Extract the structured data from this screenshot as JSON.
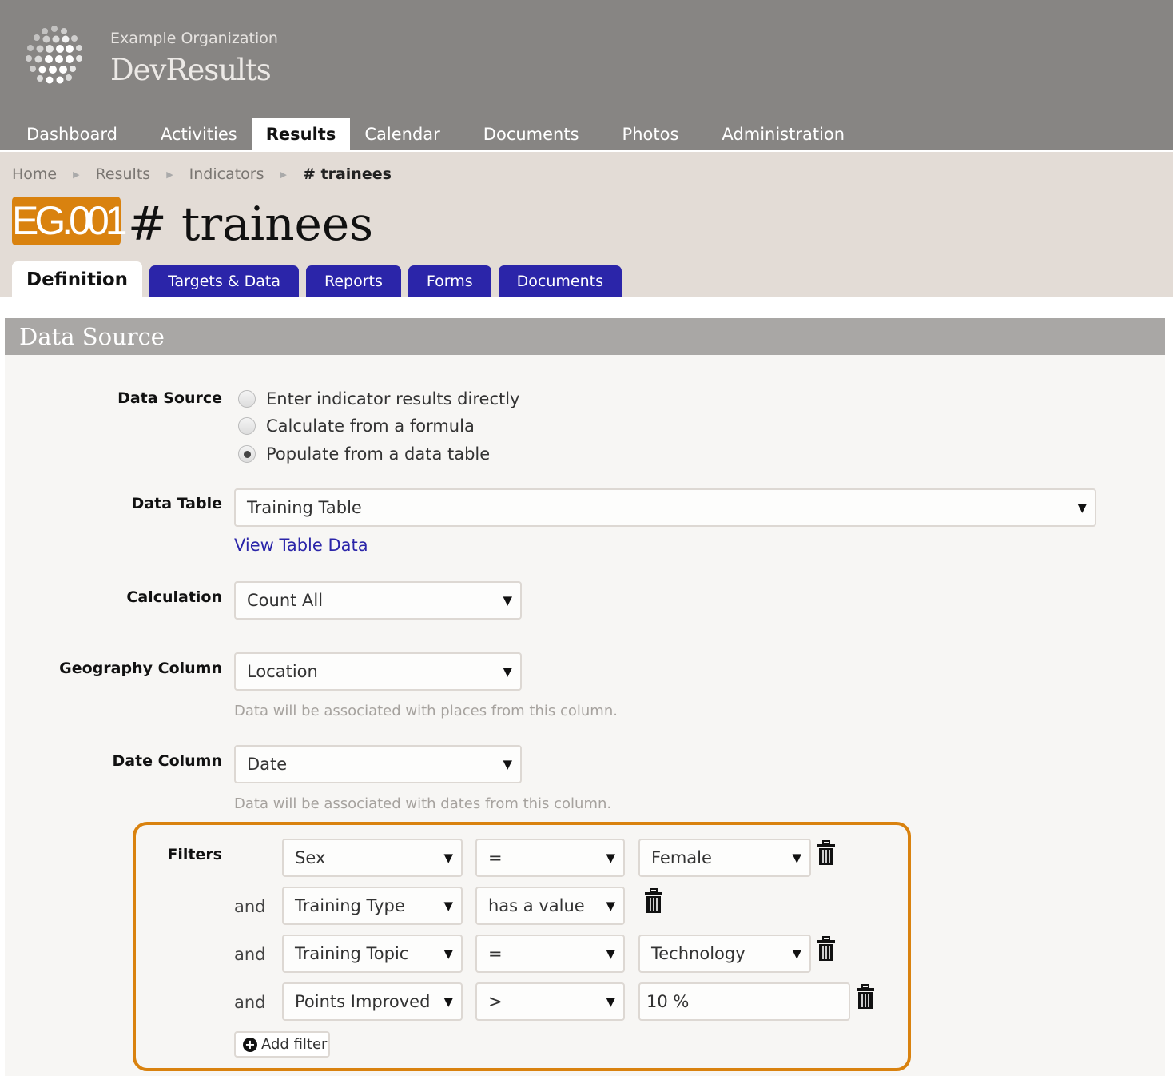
{
  "header": {
    "org": "Example Organization",
    "app": "DevResults"
  },
  "nav": [
    "Dashboard",
    "Activities",
    "Results",
    "Calendar",
    "Documents",
    "Photos",
    "Administration"
  ],
  "breadcrumb": [
    "Home",
    "Results",
    "Indicators",
    "# trainees"
  ],
  "indicator": {
    "code": "EG.001",
    "title": "# trainees",
    "code_color": "#d9820f"
  },
  "tabs": [
    "Definition",
    "Targets & Data",
    "Reports",
    "Forms",
    "Documents"
  ],
  "section": {
    "title": "Data Source"
  },
  "form": {
    "data_source_label": "Data Source",
    "options": [
      "Enter indicator results directly",
      "Calculate from a formula",
      "Populate from a data table"
    ],
    "selected_option": 2,
    "data_table_label": "Data Table",
    "data_table": "Training Table",
    "view_link": "View Table Data",
    "calculation_label": "Calculation",
    "calculation": "Count All",
    "geo_label": "Geography Column",
    "geo": "Location",
    "geo_help": "Data will be associated with places from this column.",
    "date_label": "Date Column",
    "date": "Date",
    "date_help": "Data will be associated with dates from this column.",
    "filters_label": "Filters",
    "filters": [
      {
        "conj": "",
        "column": "Sex",
        "op": "=",
        "value": "Female",
        "value_type": "select"
      },
      {
        "conj": "and",
        "column": "Training Type",
        "op": "has a value",
        "value": "",
        "value_type": "none"
      },
      {
        "conj": "and",
        "column": "Training Topic",
        "op": "=",
        "value": "Technology",
        "value_type": "select"
      },
      {
        "conj": "and",
        "column": "Points Improved",
        "op": ">",
        "value": "10 %",
        "value_type": "input"
      }
    ],
    "add_filter": "Add filter",
    "arrow": "▼"
  }
}
